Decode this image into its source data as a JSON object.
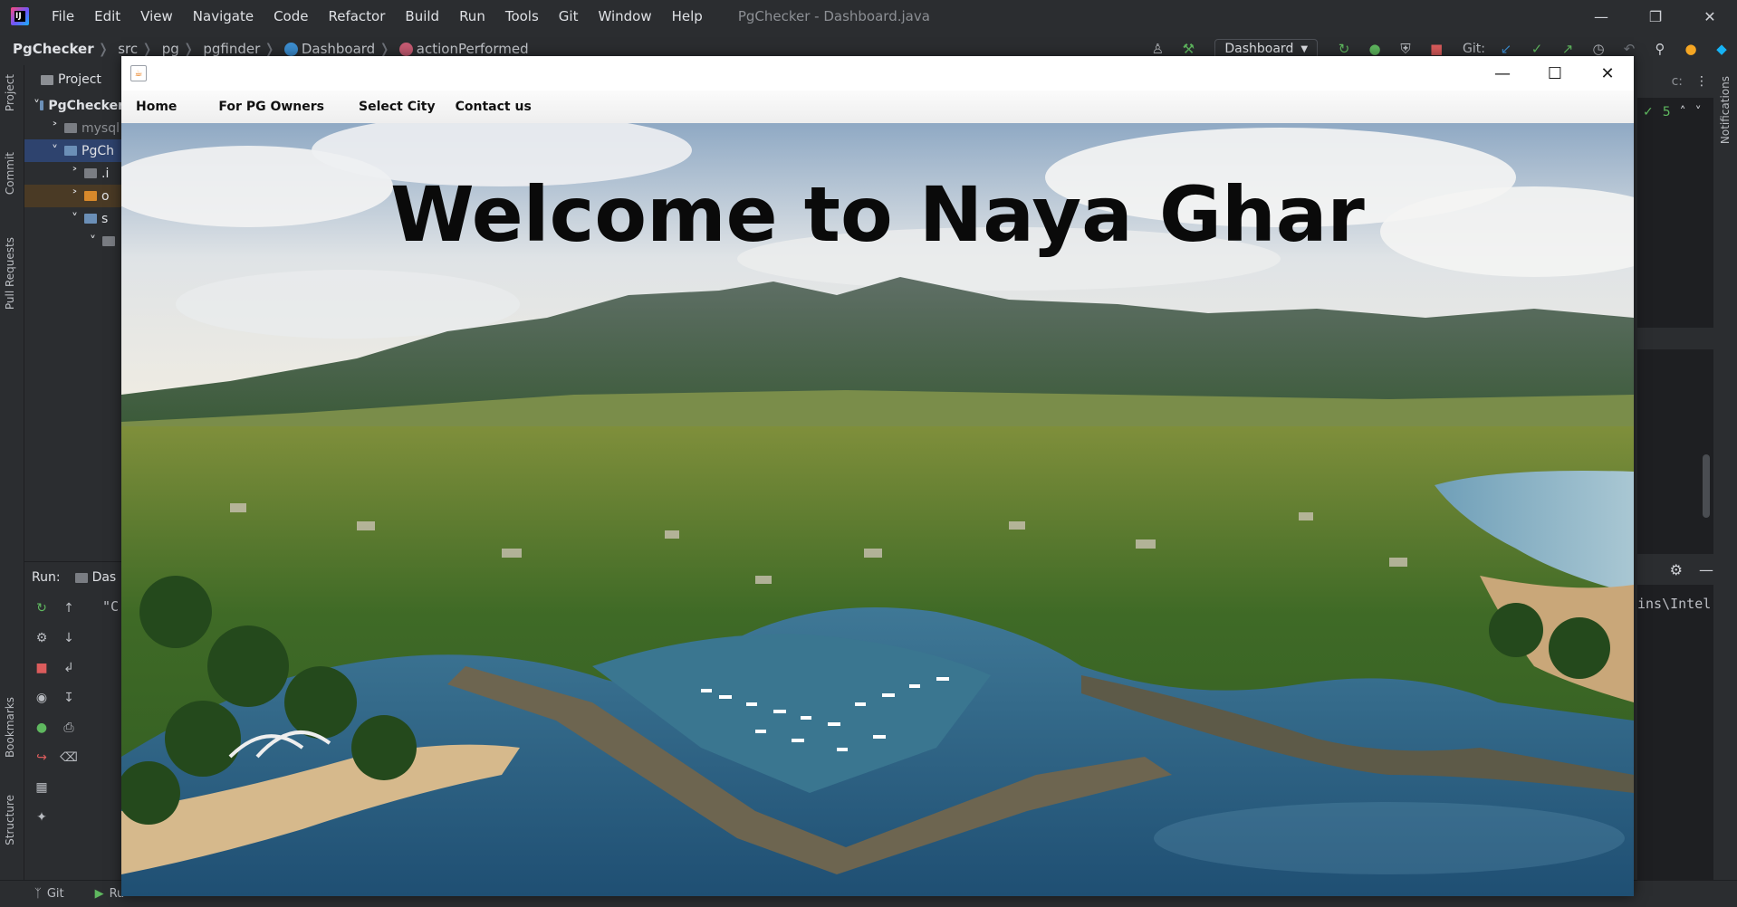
{
  "ide": {
    "logo": "IJ",
    "menu": [
      "File",
      "Edit",
      "View",
      "Navigate",
      "Code",
      "Refactor",
      "Build",
      "Run",
      "Tools",
      "Git",
      "Window",
      "Help"
    ],
    "title": "PgChecker - Dashboard.java",
    "breadcrumbs": [
      "PgChecker",
      "src",
      "pg",
      "pgfinder",
      "Dashboard",
      "actionPerformed"
    ],
    "run_config": "Dashboard",
    "git_label": "Git:",
    "left_strip": [
      "Project",
      "Commit",
      "Pull Requests",
      "Bookmarks",
      "Structure"
    ],
    "right_strip": [
      "Notifications"
    ],
    "project_panel": {
      "title": "Project",
      "rows": [
        "PgChecker",
        "mysql",
        "PgCh",
        ".i",
        "o",
        "s",
        ""
      ]
    },
    "run_panel": {
      "label": "Run:",
      "tab": "Das",
      "console": "\"C"
    },
    "editor": {
      "tab_fragment": "c:",
      "check_count": "5",
      "console_fragment": "ins\\Intel"
    },
    "status": {
      "git": "Git",
      "run": "Ru"
    },
    "colors": {
      "bg": "#2b2d30",
      "accent": "#2e436e"
    }
  },
  "app": {
    "window_icon": "java-cup-icon",
    "menu": [
      "Home",
      "For PG Owners",
      "Select City",
      "Contact us"
    ],
    "hero": {
      "title": "Welcome to Naya Ghar",
      "image": "aerial-harbor-coast-photo"
    }
  }
}
